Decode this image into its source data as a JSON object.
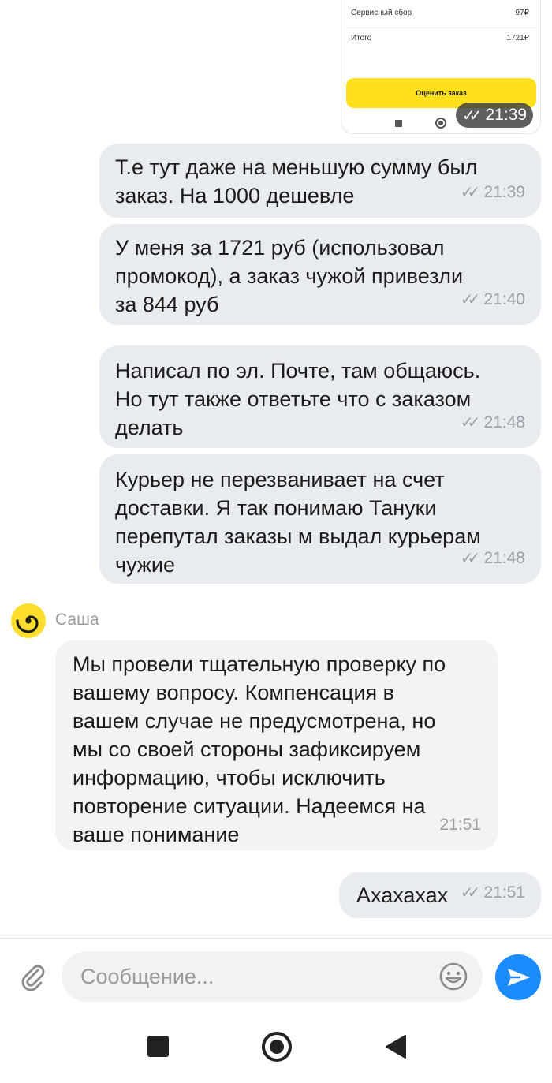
{
  "attachment": {
    "service_fee_label": "Сервисный сбор",
    "service_fee_value": "97₽",
    "total_label": "Итого",
    "total_value": "1721₽",
    "rate_button": "Оценить заказ",
    "time": "21:39"
  },
  "messages": [
    {
      "text": "Т.е тут даже на меньшую сумму был\nзаказ. На 1000 дешевле",
      "time": "21:39"
    },
    {
      "text": "У меня за 1721 руб (использовал\nпромокод), а заказ чужой привезли\nза 844 руб",
      "time": "21:40"
    },
    {
      "text": "Написал по эл. Почте, там общаюсь.\nНо тут также ответьте что с заказом\nделать",
      "time": "21:48"
    },
    {
      "text": "Курьер не перезванивает на счет\nдоставки. Я так понимаю Тануки\nперепутал заказы м выдал курьерам\nчужие",
      "time": "21:48"
    },
    {
      "sender": "Саша",
      "text": "Мы провели тщательную проверку по\nвашему вопросу. Компенсация в\nвашем случае не предусмотрена, но\nмы со своей стороны зафиксируем\nинформацию, чтобы исключить\nповторение ситуации. Надеемся на\nваше понимание",
      "time": "21:51"
    },
    {
      "text": "Ахахахах",
      "time": "21:51"
    }
  ],
  "composer": {
    "placeholder": "Сообщение..."
  },
  "icons": {
    "attach": "paperclip-icon",
    "emoji": "smiley-icon",
    "send": "send-arrow-icon",
    "read": "double-check-icon",
    "avatar": "yandex-spiral-logo"
  },
  "colors": {
    "outgoing_bubble": "#e8ecf0",
    "incoming_bubble": "#f3f3f3",
    "send_button": "#1a8cff",
    "accent_yellow": "#ffe01a"
  }
}
